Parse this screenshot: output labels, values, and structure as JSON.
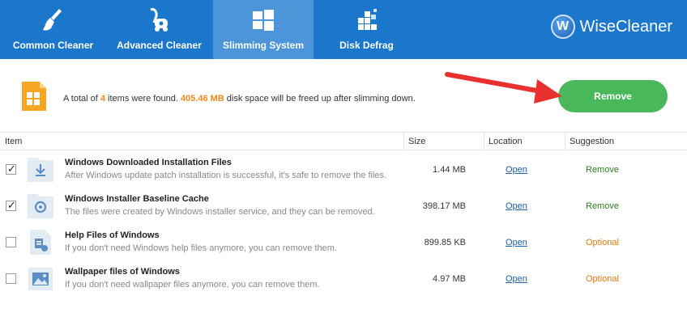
{
  "toolbar": {
    "items": [
      {
        "label": "Common Cleaner",
        "icon": "broom-icon",
        "active": false
      },
      {
        "label": "Advanced Cleaner",
        "icon": "vacuum-icon",
        "active": false
      },
      {
        "label": "Slimming System",
        "icon": "windows-icon",
        "active": true
      },
      {
        "label": "Disk Defrag",
        "icon": "defrag-icon",
        "active": false
      }
    ],
    "brand": {
      "logo_letter": "W",
      "name": "WiseCleaner"
    }
  },
  "summary": {
    "prefix": "A total of ",
    "count": "4",
    "middle": " items were found. ",
    "size": "405.46 MB",
    "suffix": " disk space will be freed up after slimming down.",
    "remove_label": "Remove"
  },
  "table": {
    "headers": {
      "item": "Item",
      "size": "Size",
      "location": "Location",
      "suggestion": "Suggestion"
    },
    "rows": [
      {
        "checked": true,
        "icon": "download-icon",
        "title": "Windows Downloaded Installation Files",
        "desc": "After Windows update patch installation is successful, it's safe to remove the files.",
        "size": "1.44 MB",
        "location": "Open",
        "suggestion": "Remove"
      },
      {
        "checked": true,
        "icon": "installer-icon",
        "title": "Windows Installer Baseline Cache",
        "desc": "The files were created by Windows installer service, and they can be removed.",
        "size": "398.17 MB",
        "location": "Open",
        "suggestion": "Remove"
      },
      {
        "checked": false,
        "icon": "help-file-icon",
        "title": "Help Files of Windows",
        "desc": "If you don't need Windows help files anymore, you can remove them.",
        "size": "899.85 KB",
        "location": "Open",
        "suggestion": "Optional"
      },
      {
        "checked": false,
        "icon": "wallpaper-icon",
        "title": "Wallpaper files of Windows",
        "desc": "If you don't need wallpaper files anymore, you can remove them.",
        "size": "4.97 MB",
        "location": "Open",
        "suggestion": "Optional"
      }
    ]
  },
  "colors": {
    "toolbar": "#1a77cc",
    "active_tab": "#4b95d8",
    "remove_button": "#49b85a",
    "highlight": "#f08a1d",
    "arrow": "#e8312f"
  }
}
